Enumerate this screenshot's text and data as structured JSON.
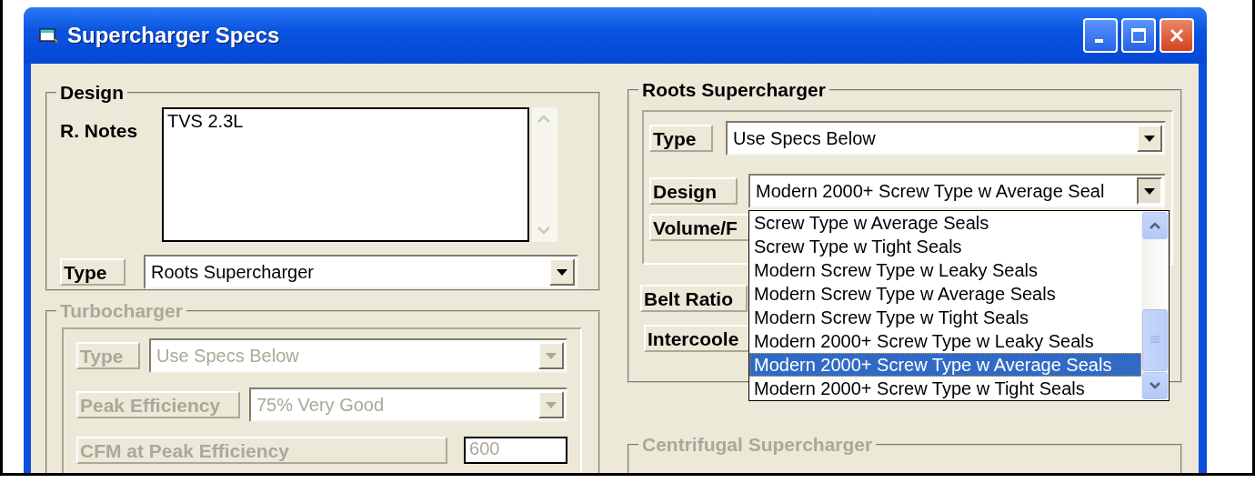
{
  "window": {
    "title": "Supercharger Specs"
  },
  "design": {
    "title": "Design",
    "notes_label": "R. Notes",
    "notes": "TVS 2.3L",
    "type_label": "Type",
    "type_value": "Roots Supercharger"
  },
  "turbocharger": {
    "title": "Turbocharger",
    "disabled": true,
    "fields": [
      {
        "label": "Type",
        "kind": "combo",
        "value": "Use Specs Below"
      },
      {
        "label": "Peak Efficiency",
        "kind": "combo",
        "value": "75% Very Good"
      },
      {
        "label": "CFM at Peak Efficiency",
        "kind": "input",
        "value": "600"
      }
    ]
  },
  "roots": {
    "title": "Roots Supercharger",
    "fields": [
      {
        "label": "Type",
        "kind": "combo",
        "value": "Use Specs Below"
      },
      {
        "label": "Design",
        "kind": "combo",
        "value": "Modern 2000+ Screw Type w Average Seal",
        "expanded": true
      },
      {
        "label": "Volume/F",
        "kind": "label"
      }
    ],
    "belt_label": "Belt Ratio",
    "intercooler_label": "Intercoole"
  },
  "dropdown": {
    "items": [
      {
        "label": "Screw Type w Average Seals",
        "selected": false
      },
      {
        "label": "Screw Type w Tight Seals",
        "selected": false
      },
      {
        "label": "Modern Screw Type w Leaky Seals",
        "selected": false
      },
      {
        "label": "Modern Screw Type w Average Seals",
        "selected": false
      },
      {
        "label": "Modern Screw Type w Tight Seals",
        "selected": false
      },
      {
        "label": "Modern 2000+ Screw Type w Leaky Seals",
        "selected": false
      },
      {
        "label": "Modern 2000+ Screw Type w Average Seals",
        "selected": true
      },
      {
        "label": "Modern 2000+ Screw Type w Tight Seals",
        "selected": false
      }
    ]
  },
  "centrifugal": {
    "title": "Centrifugal Supercharger",
    "disabled": true
  }
}
